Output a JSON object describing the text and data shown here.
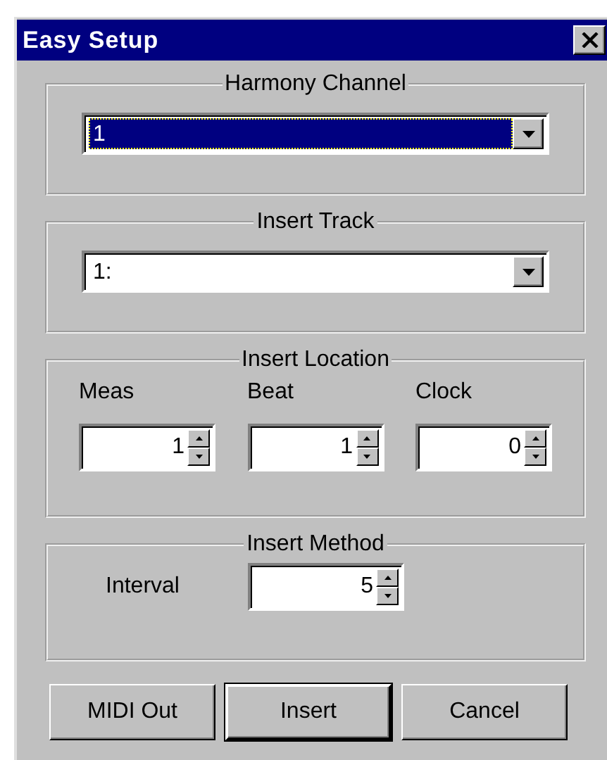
{
  "window": {
    "title": "Easy Setup"
  },
  "harmony_channel": {
    "label": "Harmony Channel",
    "value": "1",
    "focused": true
  },
  "insert_track": {
    "label": "Insert Track",
    "value": "1:",
    "focused": false
  },
  "insert_location": {
    "label": "Insert Location",
    "fields": [
      {
        "label": "Meas",
        "value": "1"
      },
      {
        "label": "Beat",
        "value": "1"
      },
      {
        "label": "Clock",
        "value": "0"
      }
    ]
  },
  "insert_method": {
    "label": "Insert Method",
    "field": {
      "label": "Interval",
      "value": "5"
    }
  },
  "buttons": [
    {
      "label": "MIDI Out",
      "default": false
    },
    {
      "label": "Insert",
      "default": true
    },
    {
      "label": "Cancel",
      "default": false
    }
  ]
}
